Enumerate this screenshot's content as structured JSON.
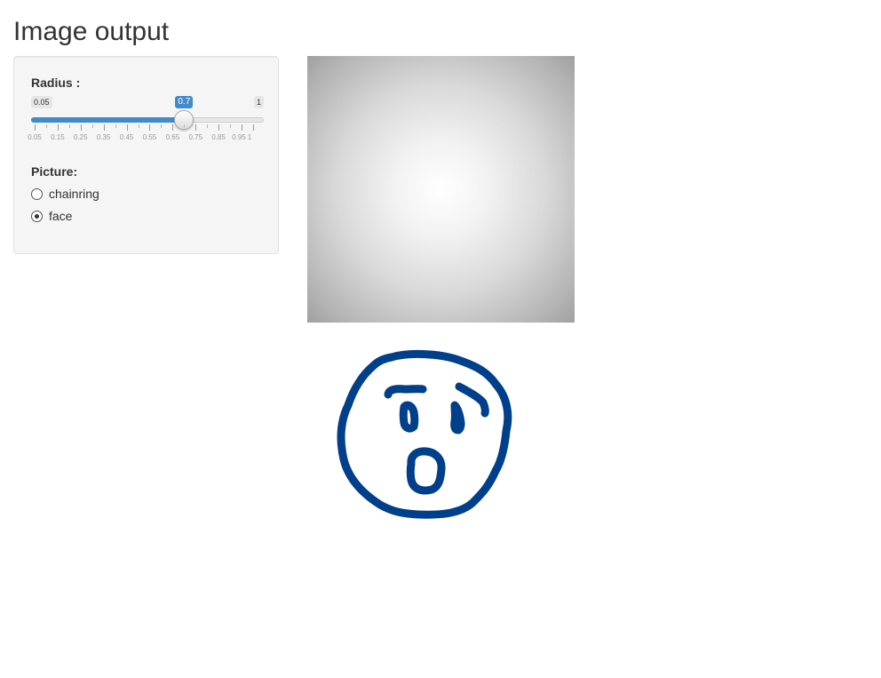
{
  "page": {
    "title": "Image output"
  },
  "sidebar": {
    "radius": {
      "label": "Radius :",
      "min_label": "0.05",
      "max_label": "1",
      "value_label": "0.7",
      "min": 0.05,
      "max": 1,
      "value": 0.7,
      "tick_labels": [
        "0.05",
        "0.15",
        "0.25",
        "0.35",
        "0.45",
        "0.55",
        "0.65",
        "0.75",
        "0.85",
        "0.95",
        "1"
      ]
    },
    "picture": {
      "label": "Picture:",
      "options": [
        {
          "label": "chainring",
          "checked": false
        },
        {
          "label": "face",
          "checked": true
        }
      ]
    }
  },
  "images": {
    "gradient": {
      "icon": "radial-gradient-image"
    },
    "face": {
      "icon": "surprised-face-drawing",
      "stroke_color": "#003f8a"
    }
  },
  "colors": {
    "accent": "#428bca"
  }
}
